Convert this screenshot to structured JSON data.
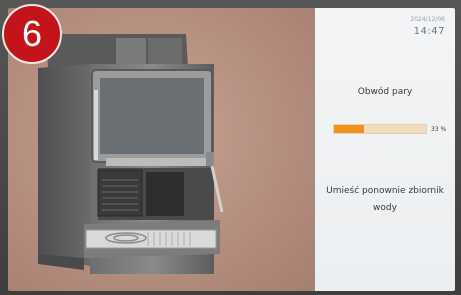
{
  "step": {
    "number": "6"
  },
  "display": {
    "date": "2024/12/06",
    "time": "14:47",
    "status_title": "Obwód pary",
    "progress": {
      "value": 0.33,
      "label": "33 %"
    },
    "instruction": "Umieść ponownie zbiornik wody"
  },
  "colors": {
    "badge": "#c4141b",
    "progress_fill": "#f0921e",
    "progress_track": "#f0ddc0"
  },
  "icons": {
    "machine": "coffee-machine-illustration"
  }
}
